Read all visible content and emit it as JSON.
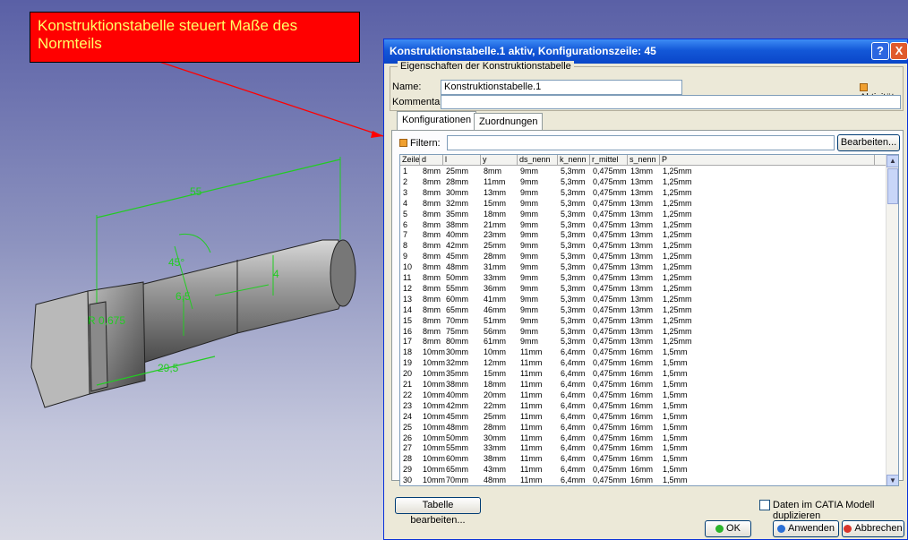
{
  "callout": {
    "text": "Konstruktionstabelle steuert Maße des Normteils"
  },
  "dimensions": {
    "length": "55",
    "thread": "4",
    "angle": "45°",
    "radius": "R 0,675",
    "shaft": "6,5",
    "head": "29,5"
  },
  "dialog": {
    "title": "Konstruktionstabelle.1 aktiv, Konfigurationszeile: 45",
    "help_label": "?",
    "close_label": "X",
    "group_label": "Eigenschaften der Konstruktionstabelle",
    "name_label": "Name:",
    "name_value": "Konstruktionstabelle.1",
    "comment_label": "Kommentar:",
    "comment_value": "",
    "activity_label": "Aktivität",
    "tabs": [
      "Konfigurationen",
      "Zuordnungen"
    ],
    "filter_label": "Filtern:",
    "filter_value": "",
    "edit_label": "Bearbeiten...",
    "columns": [
      "Zeile",
      "d",
      "l",
      "y",
      "ds_nenn",
      "k_nenn",
      "r_mittel",
      "s_nenn",
      "P"
    ],
    "rows": [
      [
        "1",
        "8mm",
        "25mm",
        "8mm",
        "9mm",
        "5,3mm",
        "0,475mm",
        "13mm",
        "1,25mm"
      ],
      [
        "2",
        "8mm",
        "28mm",
        "11mm",
        "9mm",
        "5,3mm",
        "0,475mm",
        "13mm",
        "1,25mm"
      ],
      [
        "3",
        "8mm",
        "30mm",
        "13mm",
        "9mm",
        "5,3mm",
        "0,475mm",
        "13mm",
        "1,25mm"
      ],
      [
        "4",
        "8mm",
        "32mm",
        "15mm",
        "9mm",
        "5,3mm",
        "0,475mm",
        "13mm",
        "1,25mm"
      ],
      [
        "5",
        "8mm",
        "35mm",
        "18mm",
        "9mm",
        "5,3mm",
        "0,475mm",
        "13mm",
        "1,25mm"
      ],
      [
        "6",
        "8mm",
        "38mm",
        "21mm",
        "9mm",
        "5,3mm",
        "0,475mm",
        "13mm",
        "1,25mm"
      ],
      [
        "7",
        "8mm",
        "40mm",
        "23mm",
        "9mm",
        "5,3mm",
        "0,475mm",
        "13mm",
        "1,25mm"
      ],
      [
        "8",
        "8mm",
        "42mm",
        "25mm",
        "9mm",
        "5,3mm",
        "0,475mm",
        "13mm",
        "1,25mm"
      ],
      [
        "9",
        "8mm",
        "45mm",
        "28mm",
        "9mm",
        "5,3mm",
        "0,475mm",
        "13mm",
        "1,25mm"
      ],
      [
        "10",
        "8mm",
        "48mm",
        "31mm",
        "9mm",
        "5,3mm",
        "0,475mm",
        "13mm",
        "1,25mm"
      ],
      [
        "11",
        "8mm",
        "50mm",
        "33mm",
        "9mm",
        "5,3mm",
        "0,475mm",
        "13mm",
        "1,25mm"
      ],
      [
        "12",
        "8mm",
        "55mm",
        "36mm",
        "9mm",
        "5,3mm",
        "0,475mm",
        "13mm",
        "1,25mm"
      ],
      [
        "13",
        "8mm",
        "60mm",
        "41mm",
        "9mm",
        "5,3mm",
        "0,475mm",
        "13mm",
        "1,25mm"
      ],
      [
        "14",
        "8mm",
        "65mm",
        "46mm",
        "9mm",
        "5,3mm",
        "0,475mm",
        "13mm",
        "1,25mm"
      ],
      [
        "15",
        "8mm",
        "70mm",
        "51mm",
        "9mm",
        "5,3mm",
        "0,475mm",
        "13mm",
        "1,25mm"
      ],
      [
        "16",
        "8mm",
        "75mm",
        "56mm",
        "9mm",
        "5,3mm",
        "0,475mm",
        "13mm",
        "1,25mm"
      ],
      [
        "17",
        "8mm",
        "80mm",
        "61mm",
        "9mm",
        "5,3mm",
        "0,475mm",
        "13mm",
        "1,25mm"
      ],
      [
        "18",
        "10mm",
        "30mm",
        "10mm",
        "11mm",
        "6,4mm",
        "0,475mm",
        "16mm",
        "1,5mm"
      ],
      [
        "19",
        "10mm",
        "32mm",
        "12mm",
        "11mm",
        "6,4mm",
        "0,475mm",
        "16mm",
        "1,5mm"
      ],
      [
        "20",
        "10mm",
        "35mm",
        "15mm",
        "11mm",
        "6,4mm",
        "0,475mm",
        "16mm",
        "1,5mm"
      ],
      [
        "21",
        "10mm",
        "38mm",
        "18mm",
        "11mm",
        "6,4mm",
        "0,475mm",
        "16mm",
        "1,5mm"
      ],
      [
        "22",
        "10mm",
        "40mm",
        "20mm",
        "11mm",
        "6,4mm",
        "0,475mm",
        "16mm",
        "1,5mm"
      ],
      [
        "23",
        "10mm",
        "42mm",
        "22mm",
        "11mm",
        "6,4mm",
        "0,475mm",
        "16mm",
        "1,5mm"
      ],
      [
        "24",
        "10mm",
        "45mm",
        "25mm",
        "11mm",
        "6,4mm",
        "0,475mm",
        "16mm",
        "1,5mm"
      ],
      [
        "25",
        "10mm",
        "48mm",
        "28mm",
        "11mm",
        "6,4mm",
        "0,475mm",
        "16mm",
        "1,5mm"
      ],
      [
        "26",
        "10mm",
        "50mm",
        "30mm",
        "11mm",
        "6,4mm",
        "0,475mm",
        "16mm",
        "1,5mm"
      ],
      [
        "27",
        "10mm",
        "55mm",
        "33mm",
        "11mm",
        "6,4mm",
        "0,475mm",
        "16mm",
        "1,5mm"
      ],
      [
        "28",
        "10mm",
        "60mm",
        "38mm",
        "11mm",
        "6,4mm",
        "0,475mm",
        "16mm",
        "1,5mm"
      ],
      [
        "29",
        "10mm",
        "65mm",
        "43mm",
        "11mm",
        "6,4mm",
        "0,475mm",
        "16mm",
        "1,5mm"
      ],
      [
        "30",
        "10mm",
        "70mm",
        "48mm",
        "11mm",
        "6,4mm",
        "0,475mm",
        "16mm",
        "1,5mm"
      ]
    ],
    "edit_table_label": "Tabelle bearbeiten...",
    "duplicate_label": "Daten im CATIA Modell duplizieren",
    "ok_label": "OK",
    "apply_label": "Anwenden",
    "cancel_label": "Abbrechen"
  },
  "colors": {
    "dimension": "#22cc22",
    "title_bar": "#0a46c8",
    "callout": "#ff0000",
    "callout_text": "#ffff66"
  }
}
